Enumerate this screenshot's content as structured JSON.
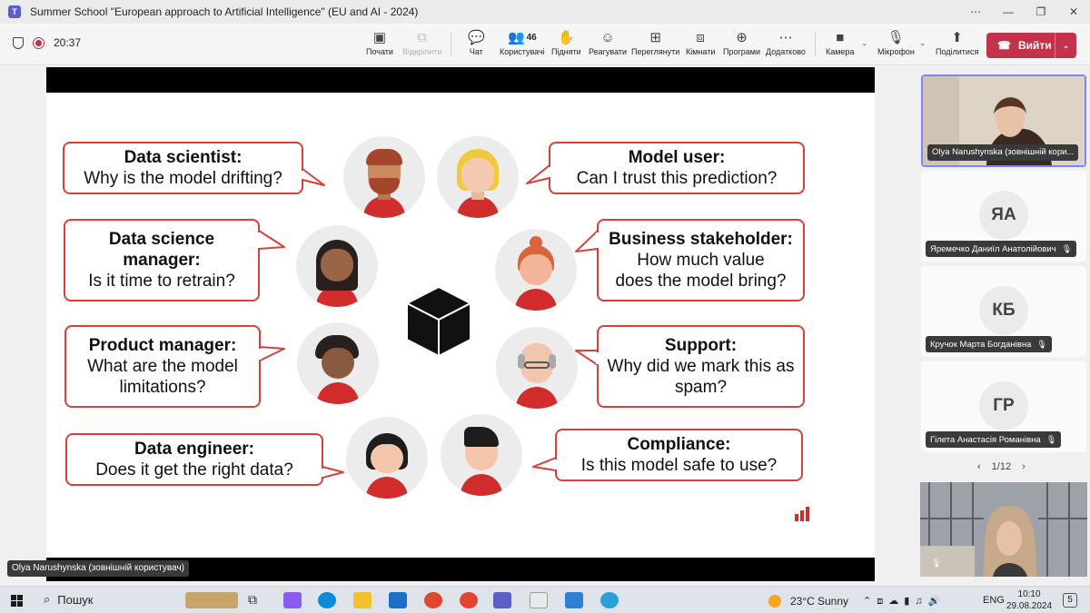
{
  "window": {
    "title": "Summer School \"European approach to Artificial Intelligence\" (EU and AI - 2024)",
    "controls": [
      "⋯",
      "—",
      "❐",
      "✕"
    ]
  },
  "meeting": {
    "elapsed": "20:37"
  },
  "toolbar": {
    "share": "Почати",
    "unpin": "Відкріпити",
    "chat": "Чат",
    "people": "Користувачі",
    "people_count": "46",
    "raise": "Підняти",
    "react": "Реагувати",
    "view": "Переглянути",
    "rooms": "Кімнати",
    "apps": "Програми",
    "more": "Додатково",
    "camera": "Камера",
    "mic": "Мікрофон",
    "share_content": "Поділитися",
    "leave": "Вийти"
  },
  "slide": {
    "bubbles": [
      {
        "role": "Data scientist:",
        "line1": "Why is the model drifting?"
      },
      {
        "role": "Model user:",
        "line1": "Can I trust this prediction?"
      },
      {
        "role": "Data science",
        "role2": "manager:",
        "line1": "Is it time to retrain?"
      },
      {
        "role": "Business stakeholder:",
        "line1": "How much value",
        "line2": "does the model bring?"
      },
      {
        "role": "Product manager:",
        "line1": "What are the model",
        "line2": "limitations?"
      },
      {
        "role": "Support:",
        "line1": "Why did we mark this as",
        "line2": "spam?"
      },
      {
        "role": "Data engineer:",
        "line1": "Does it get the right data?"
      },
      {
        "role": "Compliance:",
        "line1": "Is this model safe to use?"
      }
    ]
  },
  "presenter_label": "Olya Narushynska (зовнішній користувач)",
  "participants": [
    {
      "name": "Olya Narushynska (зовнішній кори...",
      "initials": ""
    },
    {
      "name": "Яремечко Даниїл Анатолійович",
      "initials": "ЯА"
    },
    {
      "name": "Кручок Марта Богданівна",
      "initials": "КБ"
    },
    {
      "name": "Гілета Анастасія Романівна",
      "initials": "ГР"
    }
  ],
  "pager": {
    "text": "1/12"
  },
  "taskbar": {
    "search": "Пошук",
    "weather_temp": "23°C",
    "weather_desc": "Sunny",
    "lang": "ENG",
    "time": "10:10",
    "date": "29.08.2024",
    "notifications": "5"
  },
  "colors": {
    "accent": "#d9403a",
    "leave": "#c4314b",
    "teams": "#5b5fc7"
  }
}
